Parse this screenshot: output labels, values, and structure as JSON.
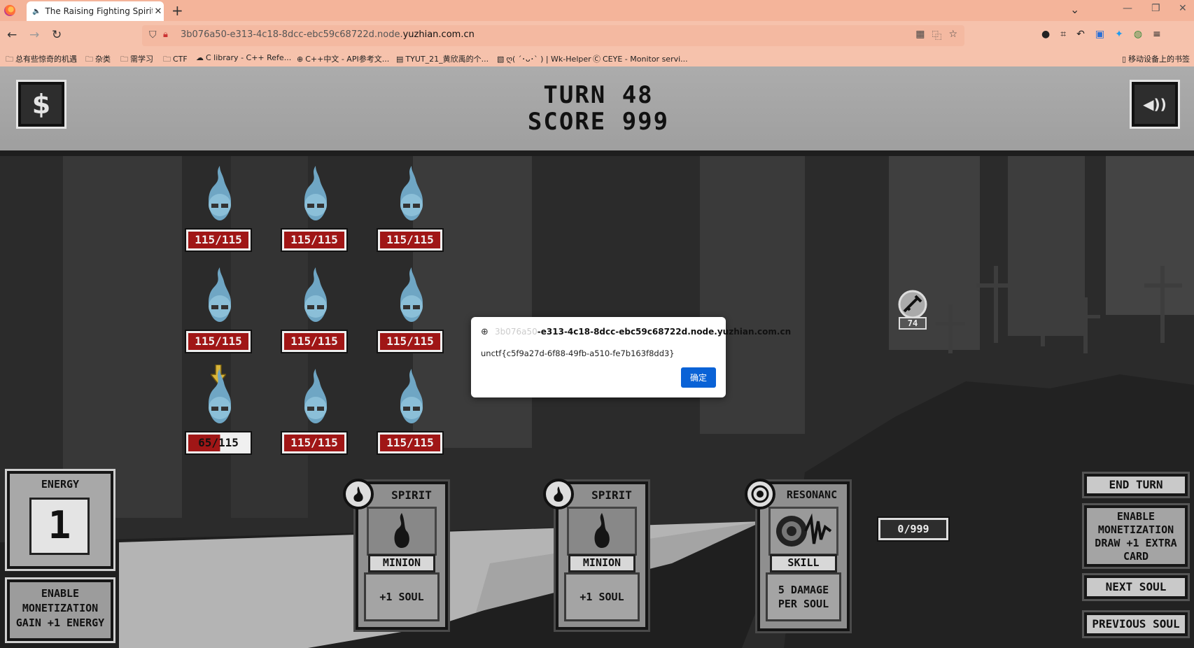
{
  "browser": {
    "tab_title": "The Raising Fighting Spirits",
    "url_prefix": "3b076a50-e313-4c18-8dcc-ebc59c68722d.node.",
    "url_domain": "yuzhian.com.cn",
    "bookmarks": [
      "总有些惊奇的机遇",
      "杂类",
      "需学习",
      "CTF",
      "C library - C++ Refe...",
      "C++中文 - API参考文...",
      "TYUT_21_黄欣禹的个...",
      "ღ( ´･ᴗ･` ) | Wk-Helper",
      "CEYE - Monitor servi...",
      "移动设备上的书签"
    ]
  },
  "game": {
    "turn_label": "TURN 48",
    "score_label": "SCORE 999",
    "shop_icon_glyph": "$",
    "sound_icon_glyph": "◀))",
    "spirits": [
      {
        "hp": "115/115"
      },
      {
        "hp": "115/115"
      },
      {
        "hp": "115/115"
      },
      {
        "hp": "115/115"
      },
      {
        "hp": "115/115"
      },
      {
        "hp": "115/115"
      },
      {
        "hp": "65/115",
        "selected": true
      },
      {
        "hp": "115/115"
      },
      {
        "hp": "115/115"
      }
    ],
    "boss_value": "74",
    "soul_counter": "0/999",
    "energy": {
      "title": "ENERGY",
      "value": "1"
    },
    "monetize_energy": "ENABLE MONETIZATION GAIN +1 ENERGY",
    "cards": [
      {
        "title": "SPIRIT",
        "type": "MINION",
        "desc": "+1 SOUL"
      },
      {
        "title": "SPIRIT",
        "type": "MINION",
        "desc": "+1 SOUL"
      },
      {
        "title": "RESONANC",
        "type": "SKILL",
        "desc": "5 DAMAGE PER SOUL"
      }
    ],
    "buttons": {
      "end_turn": "END TURN",
      "monetize_draw": "ENABLE MONETIZATION DRAW +1 EXTRA CARD",
      "next_soul": "NEXT SOUL",
      "previous_soul": "PREVIOUS SOUL"
    }
  },
  "dialog": {
    "host_faded": "3b076a50",
    "host": "-e313-4c18-8dcc-ebc59c68722d.node.yuzhian.com.cn",
    "message": "unctf{c5f9a27d-6f88-49fb-a510-fe7b163f8dd3}",
    "ok_label": "确定"
  },
  "colors": {
    "tabbar": "#f4b49a",
    "hp_red": "#a01616",
    "dialog_button": "#0a62d6"
  }
}
